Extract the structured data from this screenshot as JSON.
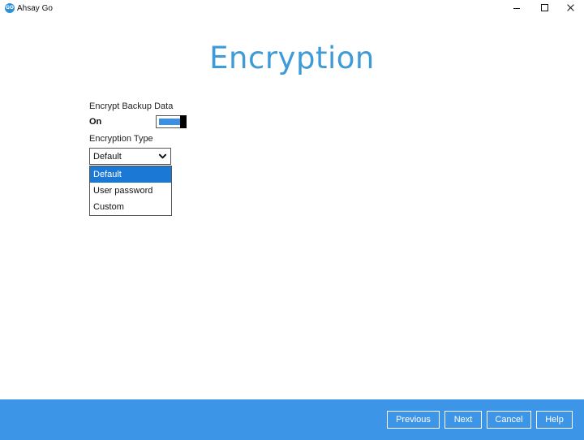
{
  "window": {
    "app_logo_text": "GO",
    "title": "Ahsay Go"
  },
  "page": {
    "title": "Encryption"
  },
  "encrypt_backup": {
    "label": "Encrypt Backup Data",
    "state_label": "On",
    "enabled": true
  },
  "encryption_type": {
    "label": "Encryption Type",
    "selected": "Default",
    "options": [
      "Default",
      "User password",
      "Custom"
    ]
  },
  "footer": {
    "previous_label": "Previous",
    "next_label": "Next",
    "cancel_label": "Cancel",
    "help_label": "Help"
  },
  "icons": {
    "select_arrow": "chevron-down-icon",
    "minimize": "minimize-icon",
    "maximize": "maximize-icon",
    "close": "close-icon"
  },
  "colors": {
    "title_blue": "#3e9bd7",
    "footer_blue": "#3c95e6",
    "selected_option": "#1b78d4",
    "toggle_fill": "#3d8fe0"
  }
}
